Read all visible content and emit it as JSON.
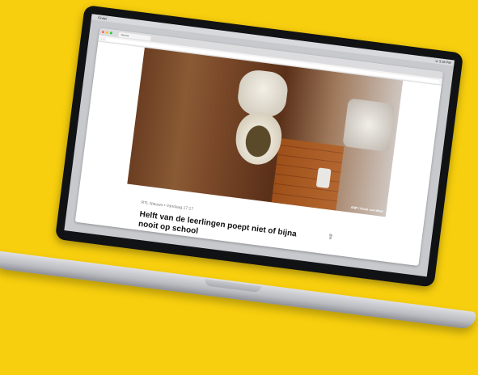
{
  "menubar": {
    "app": "Finder",
    "clock": "vr 3:18 PM"
  },
  "browser": {
    "tab_label": "Nieuws"
  },
  "article": {
    "photo_credit": "ANP / Koen van Weel",
    "meta": "RTL Nieuws  •  Vandaag 17:17",
    "headline": "Helft van de leerlingen poept niet of bijna nooit op school"
  },
  "colors": {
    "background": "#f7cf0e"
  }
}
